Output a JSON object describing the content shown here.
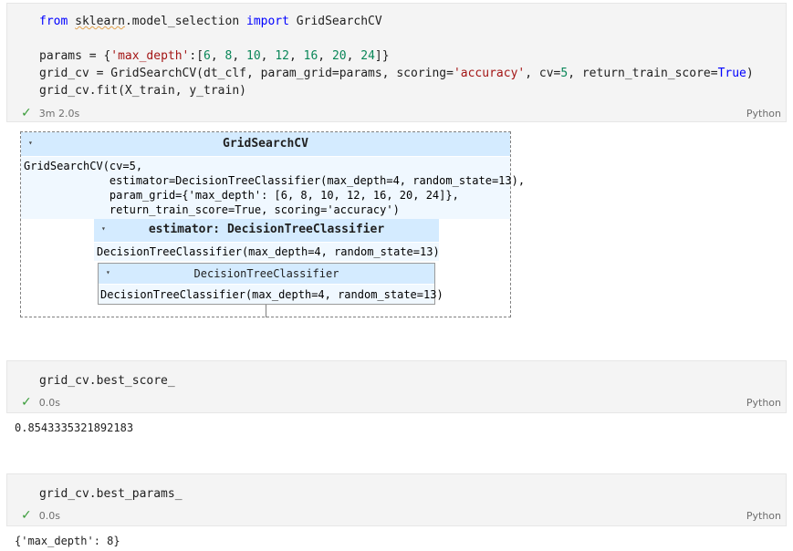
{
  "cells": [
    {
      "lines": [
        "from sklearn.model_selection import GridSearchCV",
        "",
        "params = {'max_depth':[6, 8, 10, 12, 16, 20, 24]}",
        "grid_cv = GridSearchCV(dt_clf, param_grid=params, scoring='accuracy', cv=5, return_train_score=True)",
        "grid_cv.fit(X_train, y_train)"
      ],
      "exec_time": "3m 2.0s",
      "language": "Python"
    },
    {
      "lines": [
        "grid_cv.best_score_"
      ],
      "exec_time": "0.0s",
      "language": "Python",
      "output": "0.8543335321892183"
    },
    {
      "lines": [
        "grid_cv.best_params_"
      ],
      "exec_time": "0.0s",
      "language": "Python",
      "output": "{'max_depth': 8}"
    }
  ],
  "estimator_display": {
    "outer_title": "GridSearchCV",
    "outer_repr": "GridSearchCV(cv=5,\n             estimator=DecisionTreeClassifier(max_depth=4, random_state=13),\n             param_grid={'max_depth': [6, 8, 10, 12, 16, 20, 24]},\n             return_train_score=True, scoring='accuracy')",
    "estimator_title": "estimator: DecisionTreeClassifier",
    "estimator_repr": "DecisionTreeClassifier(max_depth=4, random_state=13)",
    "inner_title": "DecisionTreeClassifier",
    "inner_repr": "DecisionTreeClassifier(max_depth=4, random_state=13)",
    "toggle_glyph": "▾"
  },
  "icons": {
    "check": "checkmark-icon",
    "toggle": "triangle-down-icon"
  },
  "colors": {
    "header_bg": "#d4ebff",
    "body_bg": "#f0f8ff",
    "check": "#3a9c3a",
    "keyword": "#0000ff",
    "string": "#a31515",
    "number": "#098658"
  }
}
